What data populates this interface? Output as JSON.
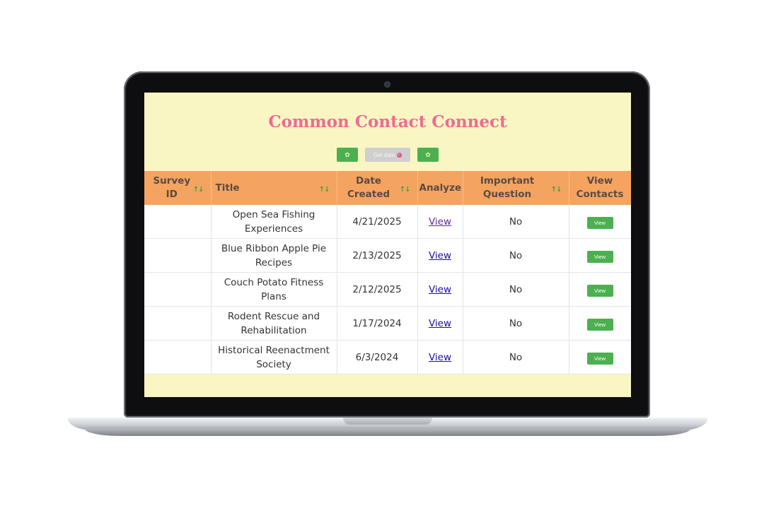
{
  "app": {
    "title": "Common Contact Connect"
  },
  "toolbar": {
    "get_data_label": "Get data"
  },
  "table": {
    "headers": {
      "survey_id": "Survey ID",
      "title": "Title",
      "date_created": "Date Created",
      "analyze": "Analyze",
      "important_question": "Important Question",
      "view_contacts": "View Contacts"
    },
    "sort_glyph": "↑↓",
    "rows": [
      {
        "survey_id": "",
        "title": "Open Sea Fishing Experiences",
        "date": "4/21/2025",
        "analyze": "View",
        "important": "No",
        "contacts": "View"
      },
      {
        "survey_id": "",
        "title": "Blue Ribbon Apple Pie Recipes",
        "date": "2/13/2025",
        "analyze": "View",
        "important": "No",
        "contacts": "View"
      },
      {
        "survey_id": "",
        "title": "Couch Potato Fitness Plans",
        "date": "2/12/2025",
        "analyze": "View",
        "important": "No",
        "contacts": "View"
      },
      {
        "survey_id": "",
        "title": "Rodent Rescue and Rehabilitation",
        "date": "1/17/2024",
        "analyze": "View",
        "important": "No",
        "contacts": "View"
      },
      {
        "survey_id": "",
        "title": "Historical Reenactment Society",
        "date": "6/3/2024",
        "analyze": "View",
        "important": "No",
        "contacts": "View"
      }
    ]
  },
  "colors": {
    "page_background": "#f9f6c3",
    "title": "#f06a93",
    "header": "#f4a460",
    "button": "#4caf50"
  },
  "icons": {
    "toolbar_left": "leaf-icon",
    "toolbar_middle": "globe-icon",
    "toolbar_right": "leaf-icon",
    "sort": "sort-arrows-icon"
  }
}
